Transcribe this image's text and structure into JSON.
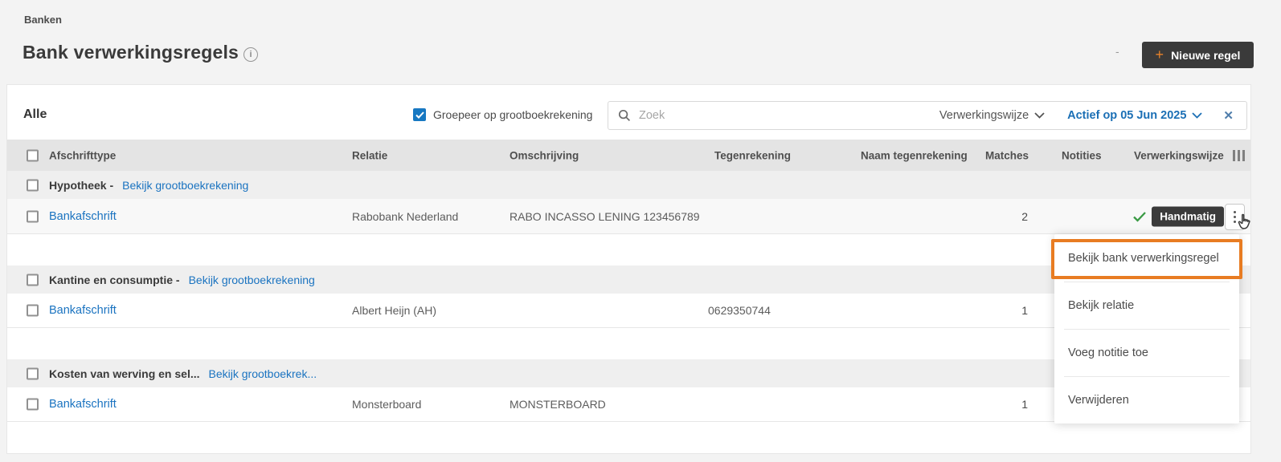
{
  "header": {
    "breadcrumb": "Banken",
    "title": "Bank verwerkingsregels",
    "info_icon": "i",
    "dash_note": "-",
    "new_rule_button": {
      "plus": "+",
      "label": "Nieuwe regel"
    }
  },
  "filters": {
    "tab_all": "Alle",
    "group_by_label": "Groepeer op grootboekrekening",
    "search_placeholder": "Zoek",
    "processing_filter": "Verwerkingswijze",
    "active_filter": "Actief op 05 Jun 2025",
    "clear_icon": "✕"
  },
  "table": {
    "headers": [
      "Afschrifttype",
      "Relatie",
      "Omschrijving",
      "Tegenrekening",
      "Naam tegenrekening",
      "Matches",
      "Notities",
      "Verwerkingswijze"
    ]
  },
  "groups": [
    {
      "title": "Hypotheek -",
      "link": "Bekijk grootboekrekening",
      "row": {
        "afschrifttype": "Bankafschrift",
        "relatie": "Rabobank Nederland",
        "omschrijving": "RABO INCASSO LENING 123456789",
        "matches": "2",
        "verwerkingswijze": "Handmatig"
      }
    },
    {
      "title": "Kantine en consumptie -",
      "link": "Bekijk grootboekrekening",
      "row": {
        "afschrifttype": "Bankafschrift",
        "relatie": "Albert Heijn (AH)",
        "tegenrekening": "0629350744",
        "matches": "1"
      }
    },
    {
      "title": "Kosten van werving en sel...",
      "link": "Bekijk grootboekrek...",
      "row": {
        "afschrifttype": "Bankafschrift",
        "relatie": "Monsterboard",
        "omschrijving": "MONSTERBOARD",
        "matches": "1"
      }
    }
  ],
  "context_menu": {
    "items": [
      "Bekijk bank verwerkingsregel",
      "Bekijk relatie",
      "Voeg notitie toe",
      "Verwijderen"
    ]
  },
  "colors": {
    "accent_orange": "#e87c22",
    "link_blue": "#1a73c0",
    "filter_blue": "#1b6fb5",
    "checkbox_blue": "#1778c2",
    "badge_dark": "#3b3b3b",
    "check_green": "#3a9a44",
    "button_plus_orange": "#e8832a"
  }
}
